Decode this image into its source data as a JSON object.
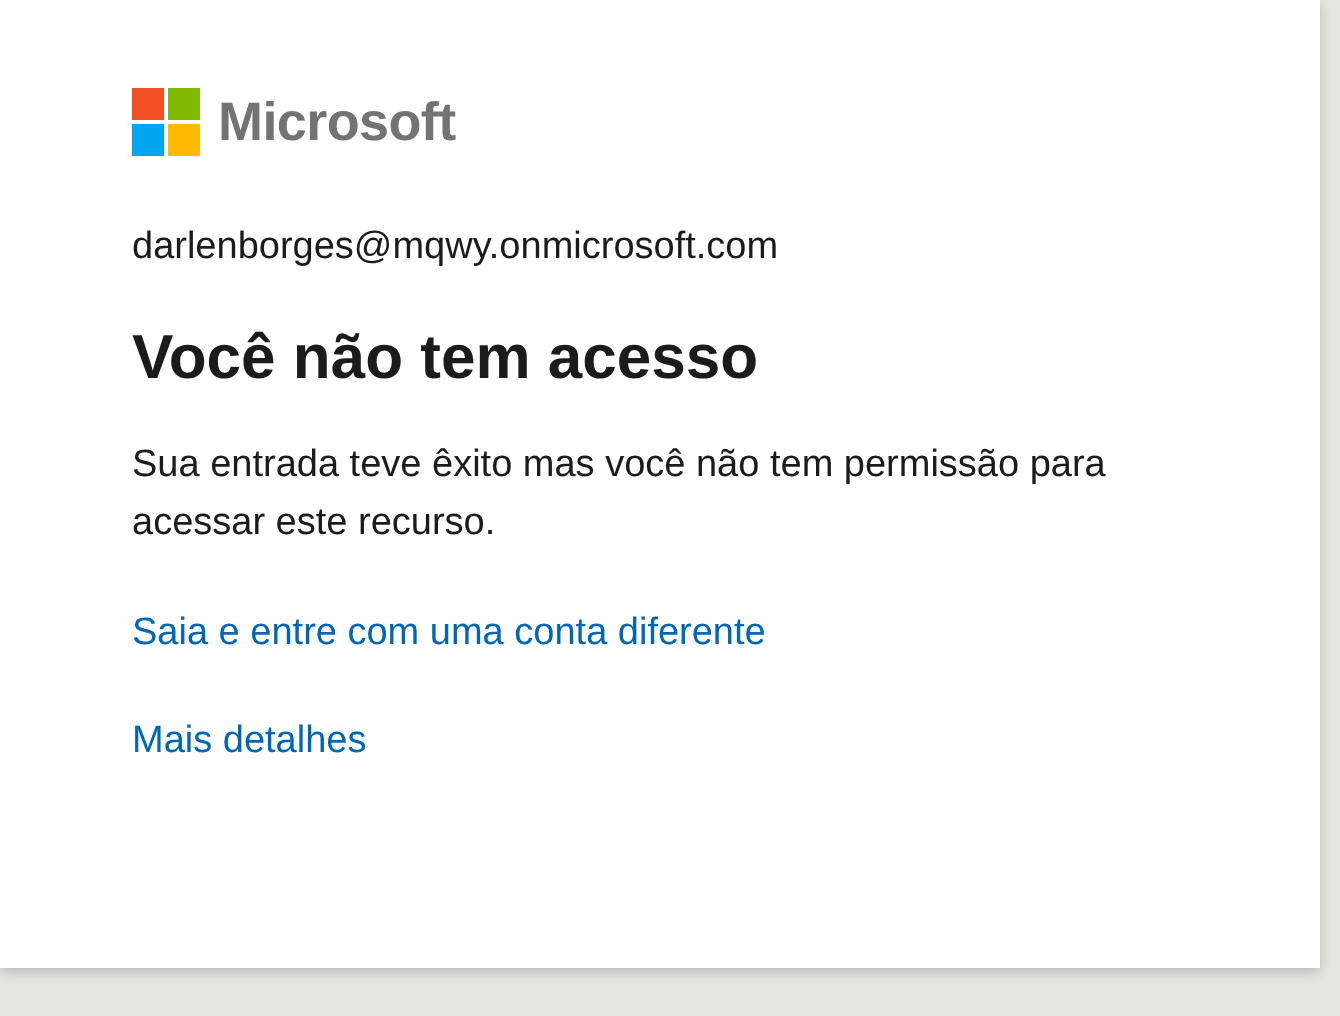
{
  "logo": {
    "text": "Microsoft"
  },
  "account": "darlenborges@mqwy.onmicrosoft.com",
  "title": "Você não tem acesso",
  "message": "Sua entrada teve êxito mas você não tem permissão para acessar este recurso.",
  "links": [
    "Saia e entre com uma conta diferente",
    "Mais detalhes"
  ]
}
